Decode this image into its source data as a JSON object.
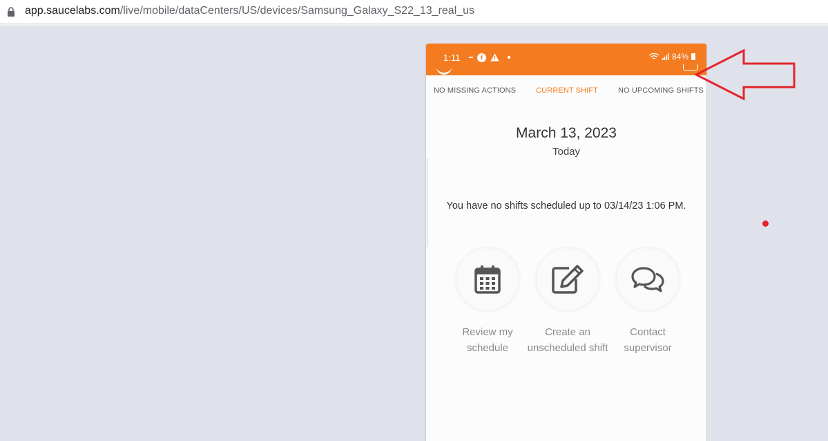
{
  "browser": {
    "url_host": "app.saucelabs.com",
    "url_path": "/live/mobile/dataCenters/US/devices/Samsung_Galaxy_S22_13_real_us"
  },
  "status_bar": {
    "time": "1:11",
    "battery": "84%",
    "accent_color": "#f47b20"
  },
  "tabs": [
    {
      "label": "NO MISSING ACTIONS",
      "active": false
    },
    {
      "label": "CURRENT SHIFT",
      "active": true
    },
    {
      "label": "NO UPCOMING SHIFTS",
      "active": false
    }
  ],
  "schedule": {
    "date": "March 13, 2023",
    "day_label": "Today",
    "message": "You have no shifts scheduled up to 03/14/23 1:06 PM."
  },
  "actions": [
    {
      "icon": "calendar-icon",
      "label": "Review my schedule"
    },
    {
      "icon": "edit-icon",
      "label": "Create an unscheduled shift"
    },
    {
      "icon": "chat-icon",
      "label": "Contact supervisor"
    }
  ],
  "annotation": {
    "color": "#e3262e"
  }
}
